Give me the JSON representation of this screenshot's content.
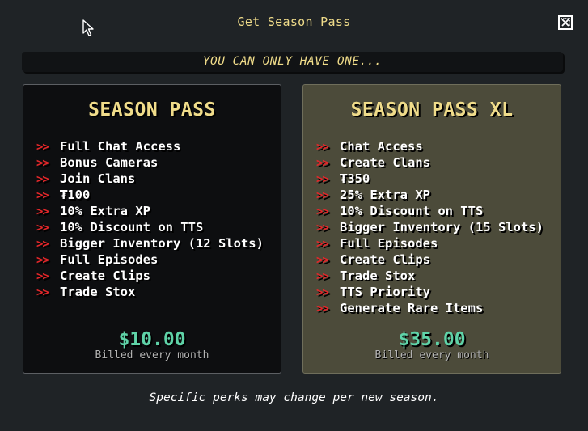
{
  "dialog": {
    "title": "Get Season Pass",
    "close_icon": "close-icon",
    "banner": "YOU CAN ONLY HAVE ONE...",
    "footer": "Specific perks may change per new season."
  },
  "colors": {
    "accent_gold": "#f0dc8a",
    "price_green": "#5fd3a8",
    "arrow_red": "#e3272a",
    "background": "#1f2326",
    "basic_card": "#0d0e10",
    "xl_card": "#4c4b3a"
  },
  "arrow_symbol": ">>",
  "plans": [
    {
      "name": "SEASON PASS",
      "price": "$10.00",
      "billing": "Billed every month",
      "perks": [
        "Full Chat Access",
        "Bonus Cameras",
        "Join Clans",
        "₮100",
        "10% Extra XP",
        "10% Discount on TTS",
        "Bigger Inventory (12 Slots)",
        "Full Episodes",
        "Create Clips",
        "Trade Stox"
      ]
    },
    {
      "name": "SEASON PASS XL",
      "price": "$35.00",
      "billing": "Billed every month",
      "perks": [
        "Chat Access",
        "Create Clans",
        "₮350",
        "25% Extra XP",
        "10% Discount on TTS",
        "Bigger Inventory (15 Slots)",
        "Full Episodes",
        "Create Clips",
        "Trade Stox",
        "TTS Priority",
        "Generate Rare Items"
      ]
    }
  ]
}
